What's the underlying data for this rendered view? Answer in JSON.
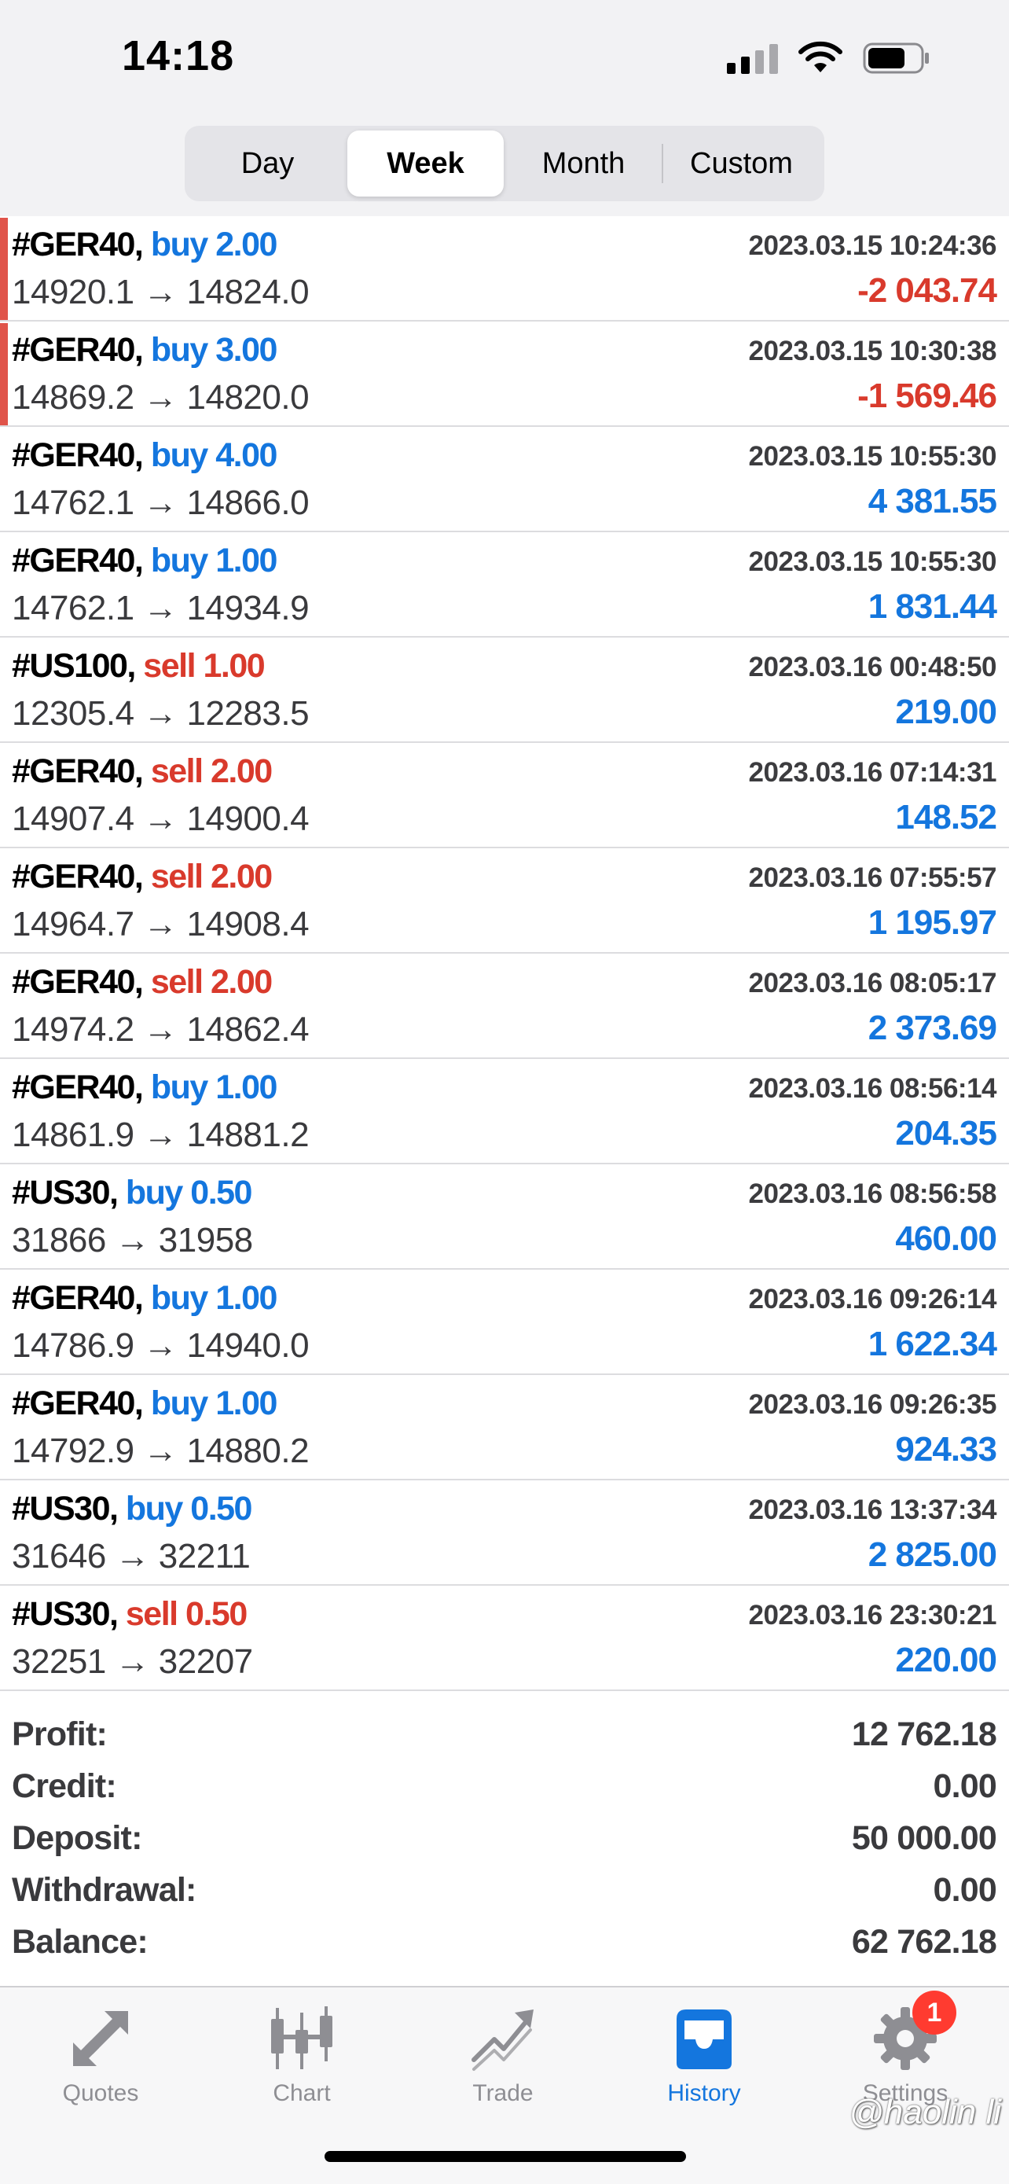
{
  "status_bar": {
    "time": "14:18"
  },
  "period_tabs": [
    {
      "label": "Day",
      "active": false
    },
    {
      "label": "Week",
      "active": true
    },
    {
      "label": "Month",
      "active": false
    },
    {
      "label": "Custom",
      "active": false
    }
  ],
  "trades": [
    {
      "symbol": "#GER40,",
      "side": "buy",
      "volume": "buy 2.00",
      "time": "2023.03.15 10:24:36",
      "prices": "14920.1 → 14824.0",
      "profit": "-2 043.74",
      "loss": true
    },
    {
      "symbol": "#GER40,",
      "side": "buy",
      "volume": "buy 3.00",
      "time": "2023.03.15 10:30:38",
      "prices": "14869.2 → 14820.0",
      "profit": "-1 569.46",
      "loss": true
    },
    {
      "symbol": "#GER40,",
      "side": "buy",
      "volume": "buy 4.00",
      "time": "2023.03.15 10:55:30",
      "prices": "14762.1 → 14866.0",
      "profit": "4 381.55",
      "loss": false
    },
    {
      "symbol": "#GER40,",
      "side": "buy",
      "volume": "buy 1.00",
      "time": "2023.03.15 10:55:30",
      "prices": "14762.1 → 14934.9",
      "profit": "1 831.44",
      "loss": false
    },
    {
      "symbol": "#US100,",
      "side": "sell",
      "volume": "sell 1.00",
      "time": "2023.03.16 00:48:50",
      "prices": "12305.4 → 12283.5",
      "profit": "219.00",
      "loss": false
    },
    {
      "symbol": "#GER40,",
      "side": "sell",
      "volume": "sell 2.00",
      "time": "2023.03.16 07:14:31",
      "prices": "14907.4 → 14900.4",
      "profit": "148.52",
      "loss": false
    },
    {
      "symbol": "#GER40,",
      "side": "sell",
      "volume": "sell 2.00",
      "time": "2023.03.16 07:55:57",
      "prices": "14964.7 → 14908.4",
      "profit": "1 195.97",
      "loss": false
    },
    {
      "symbol": "#GER40,",
      "side": "sell",
      "volume": "sell 2.00",
      "time": "2023.03.16 08:05:17",
      "prices": "14974.2 → 14862.4",
      "profit": "2 373.69",
      "loss": false
    },
    {
      "symbol": "#GER40,",
      "side": "buy",
      "volume": "buy 1.00",
      "time": "2023.03.16 08:56:14",
      "prices": "14861.9 → 14881.2",
      "profit": "204.35",
      "loss": false
    },
    {
      "symbol": "#US30,",
      "side": "buy",
      "volume": "buy 0.50",
      "time": "2023.03.16 08:56:58",
      "prices": "31866 → 31958",
      "profit": "460.00",
      "loss": false
    },
    {
      "symbol": "#GER40,",
      "side": "buy",
      "volume": "buy 1.00",
      "time": "2023.03.16 09:26:14",
      "prices": "14786.9 → 14940.0",
      "profit": "1 622.34",
      "loss": false
    },
    {
      "symbol": "#GER40,",
      "side": "buy",
      "volume": "buy 1.00",
      "time": "2023.03.16 09:26:35",
      "prices": "14792.9 → 14880.2",
      "profit": "924.33",
      "loss": false
    },
    {
      "symbol": "#US30,",
      "side": "buy",
      "volume": "buy 0.50",
      "time": "2023.03.16 13:37:34",
      "prices": "31646 → 32211",
      "profit": "2 825.00",
      "loss": false
    },
    {
      "symbol": "#US30,",
      "side": "sell",
      "volume": "sell 0.50",
      "time": "2023.03.16 23:30:21",
      "prices": "32251 → 32207",
      "profit": "220.00",
      "loss": false
    }
  ],
  "summary": [
    {
      "label": "Profit:",
      "value": "12 762.18"
    },
    {
      "label": "Credit:",
      "value": "0.00"
    },
    {
      "label": "Deposit:",
      "value": "50 000.00"
    },
    {
      "label": "Withdrawal:",
      "value": "0.00"
    },
    {
      "label": "Balance:",
      "value": "62 762.18"
    }
  ],
  "tab_bar": [
    {
      "label": "Quotes",
      "icon": "quotes-arrows-icon",
      "active": false
    },
    {
      "label": "Chart",
      "icon": "candlestick-chart-icon",
      "active": false
    },
    {
      "label": "Trade",
      "icon": "trade-trend-icon",
      "active": false
    },
    {
      "label": "History",
      "icon": "history-inbox-icon",
      "active": true
    },
    {
      "label": "Settings",
      "icon": "gear-icon",
      "active": false,
      "badge": "1"
    }
  ],
  "watermark": "@haolin li",
  "colors": {
    "accent_blue": "#1476de",
    "loss_red": "#d93a2c",
    "badge_red": "#ff3b30",
    "inactive_gray": "#8e8e93"
  }
}
